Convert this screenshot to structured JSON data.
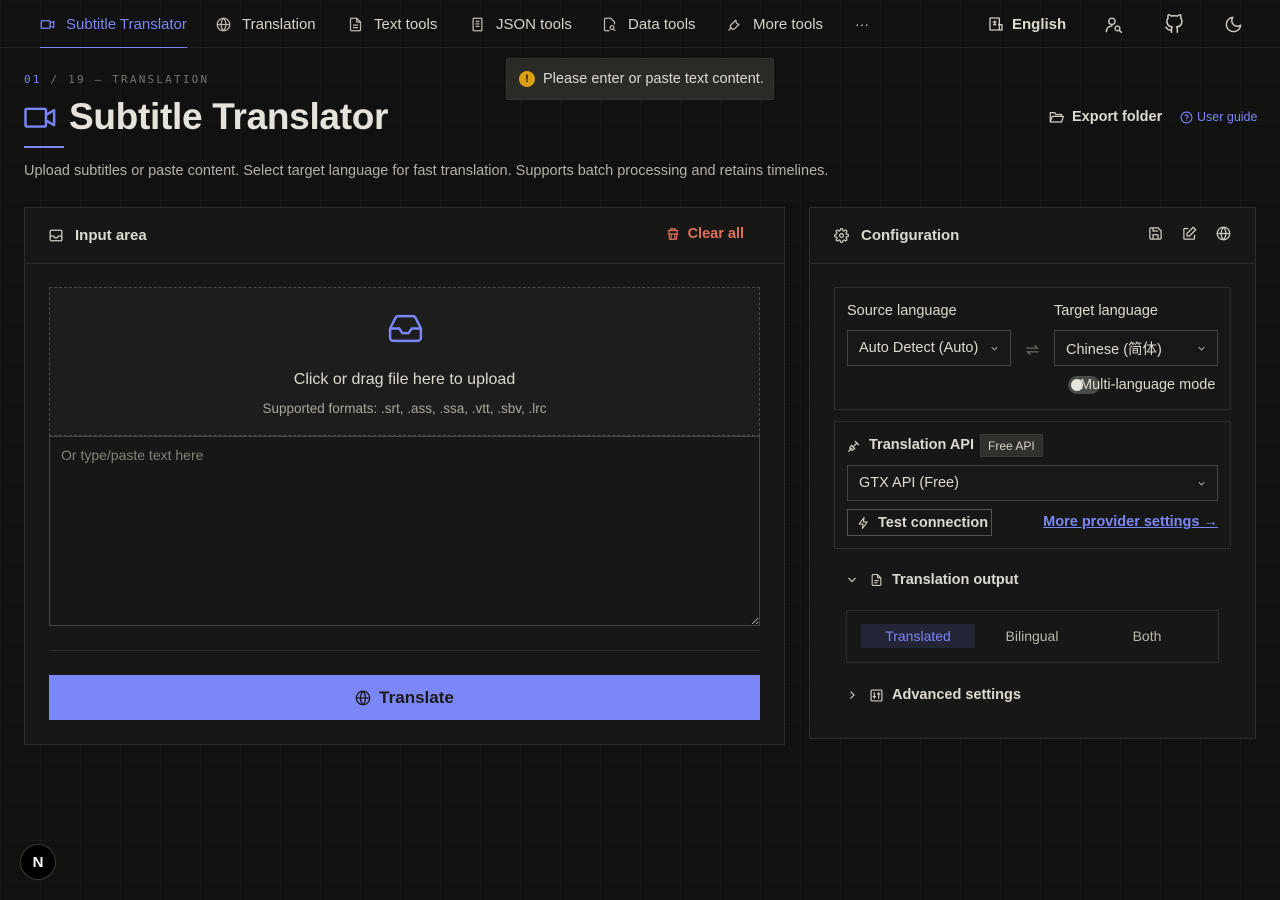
{
  "nav": {
    "items": [
      {
        "label": "Subtitle Translator",
        "icon": "video-icon"
      },
      {
        "label": "Translation",
        "icon": "globe-icon"
      },
      {
        "label": "Text tools",
        "icon": "file-text-icon"
      },
      {
        "label": "JSON tools",
        "icon": "json-file-icon"
      },
      {
        "label": "Data tools",
        "icon": "file-search-icon"
      },
      {
        "label": "More tools",
        "icon": "wrench-icon"
      }
    ],
    "more": "···",
    "language": "English"
  },
  "toast": {
    "message": "Please enter or paste text content.",
    "icon": "!"
  },
  "header": {
    "crumb_num": "01",
    "crumb_rest": " / 19 — TRANSLATION",
    "title": "Subtitle Translator",
    "description": "Upload subtitles or paste content. Select target language for fast translation. Supports batch processing and retains timelines.",
    "export_label": "Export folder",
    "guide_label": "User guide"
  },
  "input": {
    "title": "Input area",
    "clear_label": "Clear all",
    "upload_text": "Click or drag file here to upload",
    "upload_formats": "Supported formats: .srt, .ass, .ssa, .vtt, .sbv, .lrc",
    "placeholder": "Or type/paste text here",
    "translate_label": "Translate"
  },
  "config": {
    "title": "Configuration",
    "source_label": "Source language",
    "source_value": "Auto Detect (Auto)",
    "target_label": "Target language",
    "target_value": "Chinese (简体)",
    "multilang_label": "Multi-language mode",
    "multilang_on": false,
    "api_title": "Translation API",
    "api_badge": "Free API",
    "api_value": "GTX API (Free)",
    "test_label": "Test connection",
    "provider_link": "More provider settings →",
    "output_title": "Translation output",
    "output_options": [
      "Translated",
      "Bilingual",
      "Both"
    ],
    "output_selected": "Translated",
    "advanced_title": "Advanced settings"
  },
  "next_badge": "N",
  "colors": {
    "accent": "#7b86f7",
    "danger": "#e0705a",
    "warning": "#d9a012",
    "background": "#111110"
  }
}
